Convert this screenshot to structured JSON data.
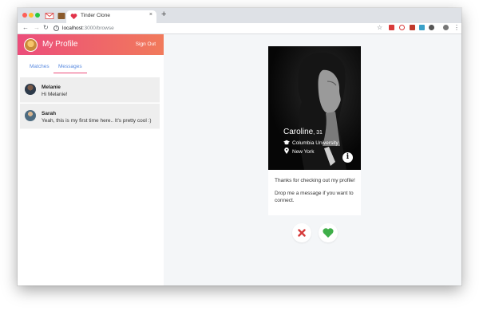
{
  "browser": {
    "tab_title": "Tinder Clone",
    "tab_close": "×",
    "new_tab": "+",
    "url_host": "localhost",
    "url_path": ":3000/browse",
    "icons": [
      "gmail-icon",
      "extension-icon",
      "heart-favicon",
      "star-icon",
      "menu-icon"
    ]
  },
  "sidebar": {
    "title": "My Profile",
    "signout_label": "Sign Out",
    "tabs": [
      {
        "label": "Matches"
      },
      {
        "label": "Messages",
        "active": true
      }
    ],
    "conversations": [
      {
        "name": "Melanie",
        "message": "Hi Melanie!"
      },
      {
        "name": "Sarah",
        "message": "Yeah, this is my first time here.. It's pretty cool :)"
      }
    ]
  },
  "profile": {
    "name": "Caroline",
    "age": ", 31",
    "school": "Columbia University",
    "location": "New York",
    "info_label": "i",
    "bio": [
      "Thanks for checking out my profile!",
      "Drop me a message if you want to connect."
    ]
  },
  "colors": {
    "accent_gradient_start": "#ec4d7b",
    "accent_gradient_end": "#f17a5b",
    "link_blue": "#5a8be0",
    "dislike_red": "#d63b3b",
    "like_green": "#3fae49"
  }
}
